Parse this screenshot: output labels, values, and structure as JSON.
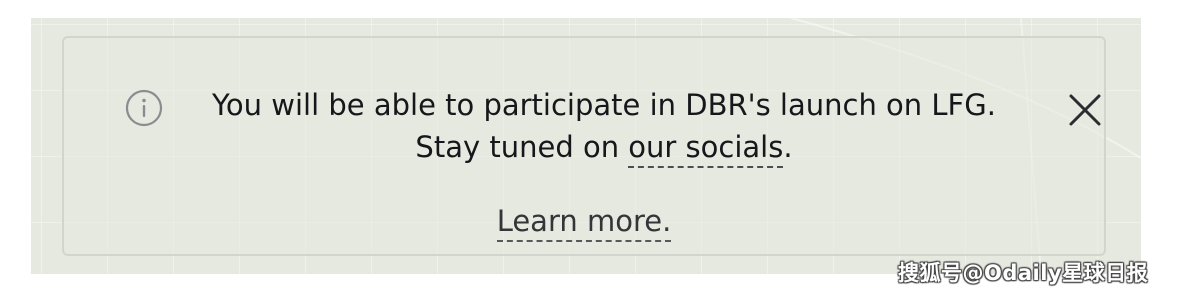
{
  "banner": {
    "info_icon": "info-circle-icon",
    "message_line1": "You will be able to participate in DBR's launch on LFG.",
    "message_line2_prefix": "Stay tuned on ",
    "socials_link": "our socials",
    "message_line2_suffix": ".",
    "learn_more": "Learn more.",
    "close_icon": "close-x-icon"
  },
  "watermark": "搜狐号@Odaily星球日报",
  "colors": {
    "panel_bg": "#e6e9e0",
    "border": "#d2d5cb",
    "text": "#15171a"
  }
}
